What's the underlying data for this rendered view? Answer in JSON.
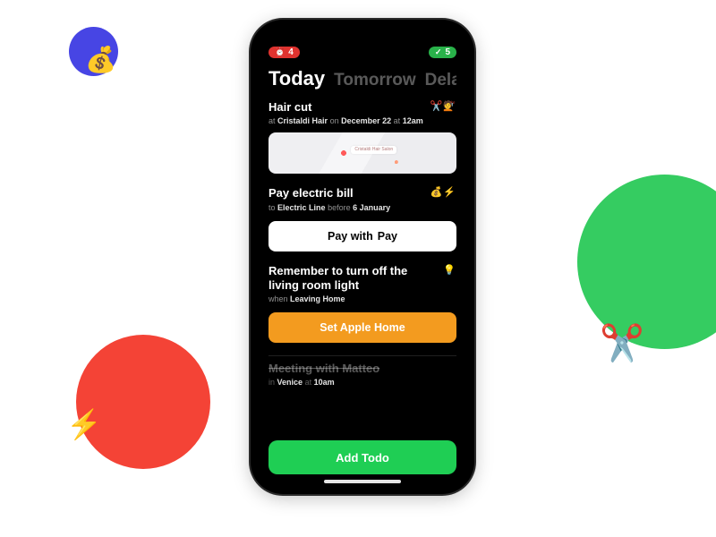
{
  "decor": {
    "moneybag": "💰",
    "bolt": "⚡",
    "scissors": "✂️"
  },
  "status": {
    "alarm_icon": "⏰",
    "alarm_count": "4",
    "done_icon": "✓",
    "done_count": "5"
  },
  "tabs": {
    "today": "Today",
    "tomorrow": "Tomorrow",
    "delayed": "Delayed"
  },
  "items": {
    "haircut": {
      "title": "Hair cut",
      "icons": "✂️💇",
      "sub_at": "at",
      "sub_place": "Cristaldi Hair",
      "sub_on": "on",
      "sub_date": "December 22",
      "sub_at2": "at",
      "sub_time": "12am",
      "map_label": "Cristaldi Hair Salon"
    },
    "bill": {
      "title": "Pay electric bill",
      "icons": "💰⚡",
      "sub_to": "to",
      "sub_name": "Electric Line",
      "sub_before": "before",
      "sub_date": "6 January",
      "pay_prefix": "Pay with",
      "pay_apple": "",
      "pay_brand": "Pay"
    },
    "light": {
      "title": "Remember to turn off the living room light",
      "icons": "💡",
      "sub_when": "when",
      "sub_cond": "Leaving Home",
      "btn": "Set Apple Home"
    },
    "meeting": {
      "title": "Meeting with Matteo",
      "sub_in": "in",
      "sub_place": "Venice",
      "sub_at": "at",
      "sub_time": "10am"
    }
  },
  "add_label": "Add Todo"
}
